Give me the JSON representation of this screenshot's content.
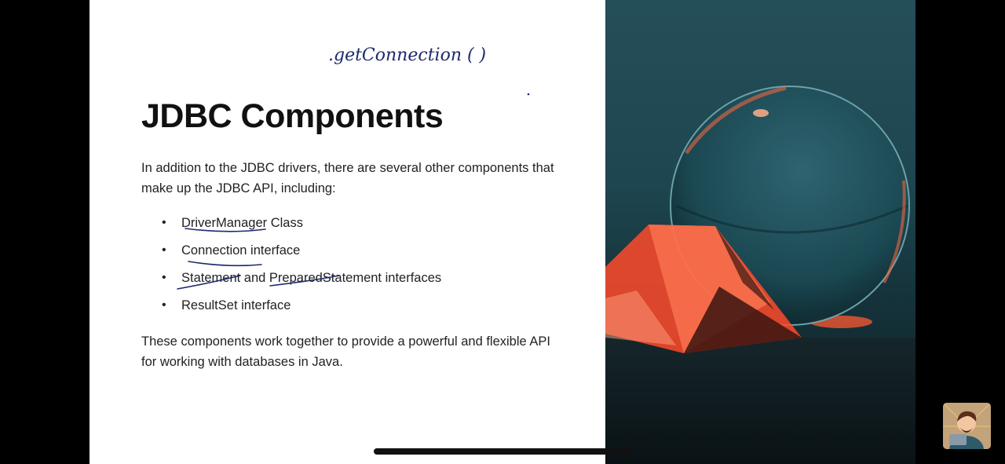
{
  "slide": {
    "title": "JDBC Components",
    "intro": "In addition to the JDBC drivers, there are several other components that make up the JDBC API, including:",
    "bullets": [
      {
        "parts": [
          "DriverManager",
          " Class"
        ]
      },
      {
        "parts": [
          "Connection interface"
        ]
      },
      {
        "parts": [
          "Statement",
          " and ",
          "PreparedStatement",
          " interfaces"
        ]
      },
      {
        "parts": [
          "ResultSet interface"
        ]
      }
    ],
    "outro": "These components work together to provide a powerful and flexible API for working with databases in Java."
  },
  "annotation": {
    "handwriting": ".getConnection (          )",
    "ink_color": "#1c2a6e"
  },
  "image": {
    "subject": "crystal ball and glass prism under red light"
  },
  "colors": {
    "background": "#000000",
    "slide": "#ffffff",
    "photo_teal": "#1e4650",
    "prism_red": "#ff4a2a"
  }
}
